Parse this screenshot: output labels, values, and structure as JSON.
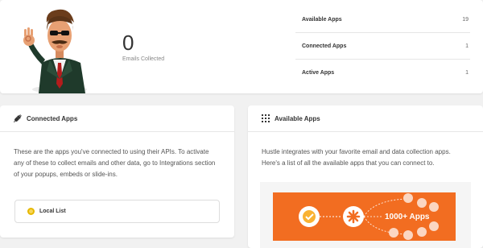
{
  "summary": {
    "emails_collected_count": "0",
    "emails_collected_label": "Emails Collected",
    "stats": [
      {
        "label": "Available Apps",
        "value": "19"
      },
      {
        "label": "Connected Apps",
        "value": "1"
      },
      {
        "label": "Active Apps",
        "value": "1"
      }
    ]
  },
  "connected_apps": {
    "title": "Connected Apps",
    "icon": "plug-icon",
    "description": "These are the apps you've connected to using their APIs. To activate any of these to collect emails and other data, go to Integrations section of your popups, embeds or slide-ins.",
    "items": [
      {
        "label": "Local List",
        "icon": "local-list-icon"
      }
    ]
  },
  "available_apps": {
    "title": "Available Apps",
    "icon": "grid-icon",
    "description": "Hustle integrates with your favorite email and data collection apps. Here's a list of all the available apps that you can connect to.",
    "promo_text": "1000+ Apps",
    "promo_color": "#f26d21"
  },
  "colors": {
    "page_bg": "#f1f1f1",
    "accent_orange": "#f26d21",
    "local_list_yellow": "#e6b800"
  }
}
